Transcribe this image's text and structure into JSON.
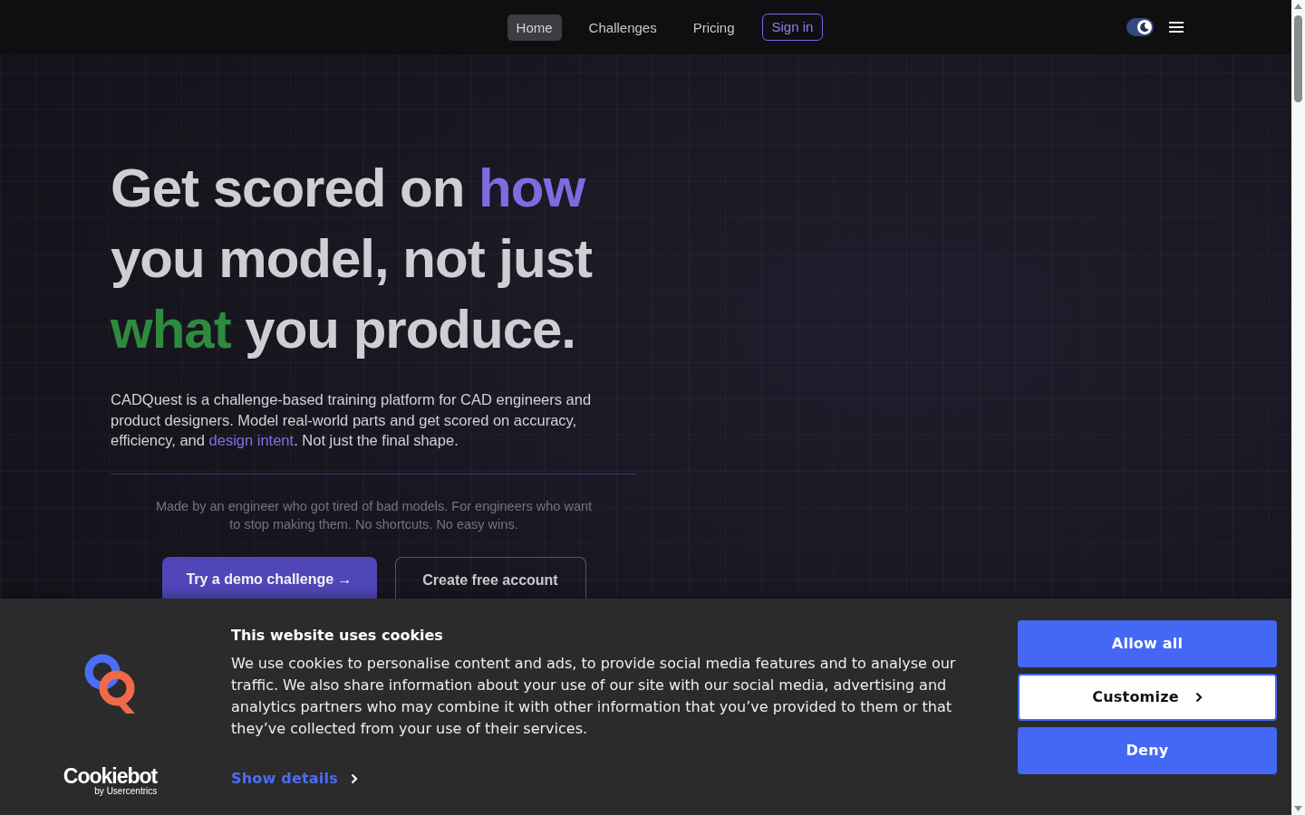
{
  "navbar": {
    "links": [
      {
        "label": "Home",
        "selected": true
      },
      {
        "label": "Challenges",
        "selected": false
      },
      {
        "label": "Pricing",
        "selected": false
      }
    ],
    "sign_in": "Sign in",
    "theme_toggle": {
      "on": true
    }
  },
  "hero": {
    "headline": [
      [
        {
          "text": "Get scored on ",
          "color": "#cfcfd3"
        },
        {
          "text": "how",
          "color": "#7d6ce0"
        }
      ],
      [
        {
          "text": "you model, not just",
          "color": "#cfcfd3"
        }
      ],
      [
        {
          "text": "what",
          "color": "#2e8b3d"
        },
        {
          "text": " you produce.",
          "color": "#cfcfd3"
        }
      ]
    ],
    "description": [
      {
        "kind": "text",
        "text": "CADQuest is a challenge-based training platform for CAD engineers and product designers. Model real-world parts and get scored on accuracy, efficiency, and "
      },
      {
        "kind": "link",
        "text": "design intent"
      },
      {
        "kind": "text",
        "text": ". Not just the final shape."
      }
    ],
    "tagline": "Made by an engineer who got tired of bad models. For engineers who want to stop making them. No shortcuts. No easy wins.",
    "buttons": [
      {
        "label": "Try a demo challenge →",
        "kind": "primary"
      },
      {
        "label": "Create free account",
        "kind": "outline"
      }
    ]
  },
  "cookie_banner": {
    "cookiebot_logo": {
      "wordmark": "Cookiebot",
      "tagline": "by Usercentrics"
    },
    "title": "This website uses cookies",
    "text": "We use cookies to personalise content and ads, to provide social media features and to analyse our traffic. We also share information about your use of our site with our social media, advertising and analytics partners who may combine it with other information that you’ve provided to them or that they’ve collected from your use of their services.",
    "details_link": "Show details",
    "buttons": [
      {
        "label": "Allow all",
        "kind": "primary"
      },
      {
        "label": "Customize",
        "kind": "secondary"
      },
      {
        "label": "Deny",
        "kind": "primary"
      }
    ]
  }
}
